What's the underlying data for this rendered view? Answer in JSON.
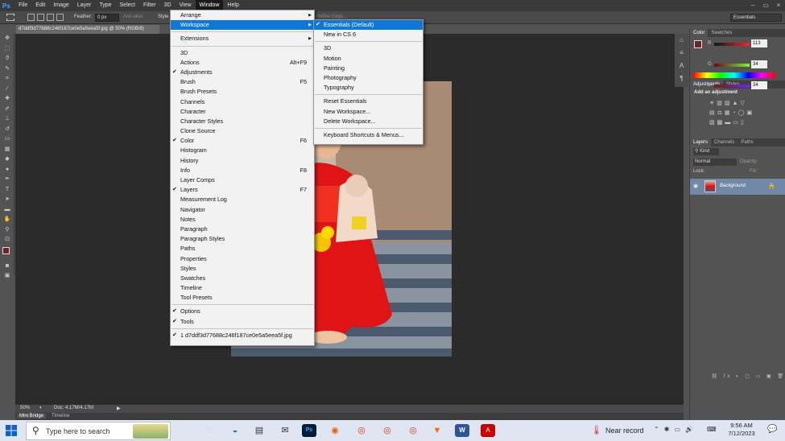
{
  "app": {
    "logo": "Ps"
  },
  "menubar": [
    "File",
    "Edit",
    "Image",
    "Layer",
    "Type",
    "Select",
    "Filter",
    "3D",
    "View",
    "Window",
    "Help"
  ],
  "window_controls": [
    "–",
    "▭",
    "×"
  ],
  "options_bar": {
    "feather_label": "Feather:",
    "feather_value": "0 px",
    "anti_alias": "Anti-alias",
    "style_label": "Style",
    "refine_edge": "Refine Edge...",
    "workspace_select": "Essentials"
  },
  "document_tab": "d7ddf3d77688c246f187ce0e5a5eea5f.jpg @ 50% (RGB/8)",
  "status": {
    "zoom": "50%",
    "doc": "Doc: 4.17M/4.17M"
  },
  "bottom_tabs": [
    "Mini Bridge",
    "Timeline"
  ],
  "window_menu": {
    "items": [
      {
        "label": "Arrange",
        "submenu": true
      },
      {
        "label": "Workspace",
        "submenu": true,
        "highlight": true
      },
      {
        "sep": true
      },
      {
        "label": "Extensions",
        "submenu": true
      },
      {
        "sep": true
      },
      {
        "label": "3D"
      },
      {
        "label": "Actions",
        "shortcut": "Alt+F9"
      },
      {
        "label": "Adjustments",
        "checked": true
      },
      {
        "label": "Brush",
        "shortcut": "F5"
      },
      {
        "label": "Brush Presets"
      },
      {
        "label": "Channels"
      },
      {
        "label": "Character"
      },
      {
        "label": "Character Styles"
      },
      {
        "label": "Clone Source"
      },
      {
        "label": "Color",
        "checked": true,
        "shortcut": "F6"
      },
      {
        "label": "Histogram"
      },
      {
        "label": "History"
      },
      {
        "label": "Info",
        "shortcut": "F8"
      },
      {
        "label": "Layer Comps"
      },
      {
        "label": "Layers",
        "checked": true,
        "shortcut": "F7"
      },
      {
        "label": "Measurement Log"
      },
      {
        "label": "Navigator"
      },
      {
        "label": "Notes"
      },
      {
        "label": "Paragraph"
      },
      {
        "label": "Paragraph Styles"
      },
      {
        "label": "Paths"
      },
      {
        "label": "Properties"
      },
      {
        "label": "Styles"
      },
      {
        "label": "Swatches"
      },
      {
        "label": "Timeline"
      },
      {
        "label": "Tool Presets"
      },
      {
        "sep": true
      },
      {
        "label": "Options",
        "checked": true
      },
      {
        "label": "Tools",
        "checked": true
      },
      {
        "sep": true
      },
      {
        "label": "1 d7ddf3d77688c246f187ce0e5a5eea5f.jpg",
        "checked": true
      }
    ]
  },
  "workspace_menu": {
    "items": [
      {
        "label": "Essentials (Default)",
        "checked": true,
        "highlight": true
      },
      {
        "label": "New in CS 6"
      },
      {
        "sep": true
      },
      {
        "label": "3D"
      },
      {
        "label": "Motion"
      },
      {
        "label": "Painting"
      },
      {
        "label": "Photography"
      },
      {
        "label": "Typography"
      },
      {
        "sep": true
      },
      {
        "label": "Reset Essentials"
      },
      {
        "label": "New Workspace..."
      },
      {
        "label": "Delete Workspace..."
      },
      {
        "sep": true
      },
      {
        "label": "Keyboard Shortcuts & Menus..."
      }
    ]
  },
  "color_panel": {
    "tabs": [
      "Color",
      "Swatches"
    ],
    "r": {
      "label": "R",
      "value": "113"
    },
    "g": {
      "label": "G",
      "value": "34"
    },
    "b": {
      "label": "B",
      "value": "34"
    },
    "foreground": "#712222"
  },
  "adjustments_panel": {
    "tabs": [
      "Adjustments",
      "Styles"
    ],
    "title": "Add an adjustment"
  },
  "layers_panel": {
    "tabs": [
      "Layers",
      "Channels",
      "Paths"
    ],
    "kind": "Kind",
    "blend": "Normal",
    "opacity_label": "Opacity:",
    "lock_label": "Lock:",
    "fill_label": "Fill:",
    "layer_name": "Background"
  },
  "taskbar": {
    "search_placeholder": "Type here to search",
    "weather": "Near record",
    "time": "9:56 AM",
    "date": "7/12/2023"
  }
}
